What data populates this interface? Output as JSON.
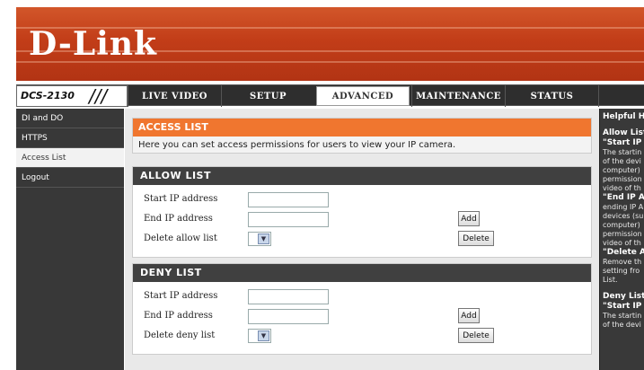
{
  "brand": {
    "logo": "D-Link"
  },
  "model": "DCS-2130",
  "nav": {
    "tabs": [
      {
        "label": "LIVE VIDEO"
      },
      {
        "label": "SETUP"
      },
      {
        "label": "ADVANCED"
      },
      {
        "label": "MAINTENANCE"
      },
      {
        "label": "STATUS"
      }
    ]
  },
  "sidebar": {
    "items": [
      {
        "label": "DI and DO"
      },
      {
        "label": "HTTPS"
      },
      {
        "label": "Access List"
      },
      {
        "label": "Logout"
      }
    ]
  },
  "access": {
    "title": "ACCESS LIST",
    "description": "Here you can set access permissions for users to view your IP camera."
  },
  "allow": {
    "title": "ALLOW LIST",
    "start_label": "Start IP address",
    "start_value": "",
    "end_label": "End IP address",
    "end_value": "",
    "delete_label": "Delete allow list",
    "add_button": "Add",
    "delete_button": "Delete"
  },
  "deny": {
    "title": "DENY LIST",
    "start_label": "Start IP address",
    "start_value": "",
    "end_label": "End IP address",
    "end_value": "",
    "delete_label": "Delete deny list",
    "add_button": "Add",
    "delete_button": "Delete"
  },
  "help": {
    "title": "Helpful Hi",
    "lines": [
      {
        "kind": "sub",
        "text": "Allow List"
      },
      {
        "kind": "sub",
        "text": "\"Start IP"
      },
      {
        "kind": "text",
        "text": "The startin"
      },
      {
        "kind": "text",
        "text": "of the devi"
      },
      {
        "kind": "text",
        "text": "computer)"
      },
      {
        "kind": "text",
        "text": "permission"
      },
      {
        "kind": "text",
        "text": "video of th"
      },
      {
        "kind": "sub",
        "text": "\"End IP A"
      },
      {
        "kind": "text",
        "text": "ending IP A"
      },
      {
        "kind": "text",
        "text": "devices (su"
      },
      {
        "kind": "text",
        "text": "computer)"
      },
      {
        "kind": "text",
        "text": "permission"
      },
      {
        "kind": "text",
        "text": "video of th"
      },
      {
        "kind": "sub",
        "text": "\"Delete A"
      },
      {
        "kind": "text",
        "text": "Remove th"
      },
      {
        "kind": "text",
        "text": "setting fro"
      },
      {
        "kind": "text",
        "text": "List."
      },
      {
        "kind": "gap",
        "text": ""
      },
      {
        "kind": "sub",
        "text": "Deny List"
      },
      {
        "kind": "sub",
        "text": "\"Start IP"
      },
      {
        "kind": "text",
        "text": "The startin"
      },
      {
        "kind": "text",
        "text": "of the devi"
      }
    ]
  },
  "colors": {
    "banner": "#c4421c",
    "accent": "#f0762f",
    "section_header": "#404040",
    "sidebar": "#383838"
  }
}
